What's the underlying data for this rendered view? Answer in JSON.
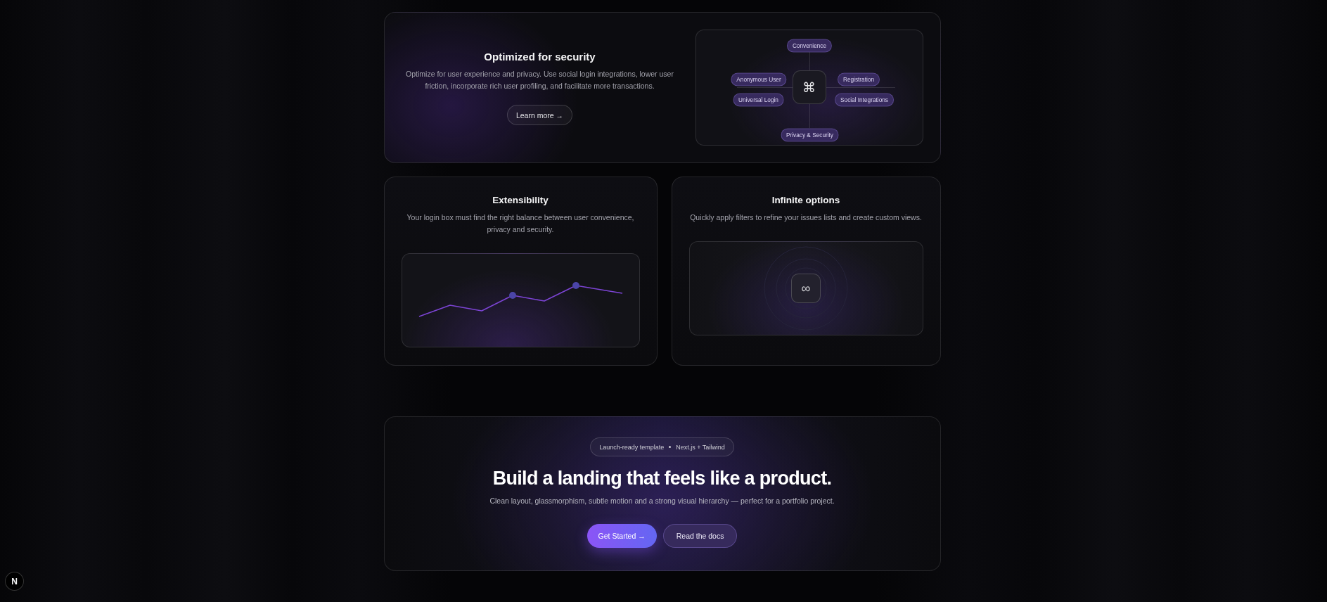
{
  "feature_top": {
    "title": "Optimized for security",
    "description": "Optimize for user experience and privacy. Use social login integrations, lower user friction, incorporate rich user profiling, and facilitate more transactions.",
    "button": "Learn more →",
    "diagram": {
      "center": "⌘",
      "nodes": [
        "Convenience",
        "Anonymous User",
        "Registration",
        "Universal Login",
        "Social Integrations",
        "Privacy & Security"
      ]
    }
  },
  "features": [
    {
      "kind": "chart",
      "title": "Extensibility",
      "description": "Your login box must find the right balance between user convenience, privacy and security."
    },
    {
      "kind": "rings",
      "title": "Infinite options",
      "description": "Quickly apply filters to refine your issues lists and create custom views.",
      "symbol": "∞"
    }
  ],
  "cta": {
    "badge": [
      "Launch-ready template",
      "Next.js + Tailwind"
    ],
    "heading": "Build a landing that feels like a product.",
    "subtitle": "Clean layout, glassmorphism, subtle motion and a strong visual hierarchy — perfect for a portfolio project.",
    "buttons": [
      {
        "kind": "primary",
        "label": "Get Started →"
      },
      {
        "kind": "secondary",
        "label": "Read the docs"
      }
    ]
  },
  "dev_indicator": {
    "label": "N"
  }
}
